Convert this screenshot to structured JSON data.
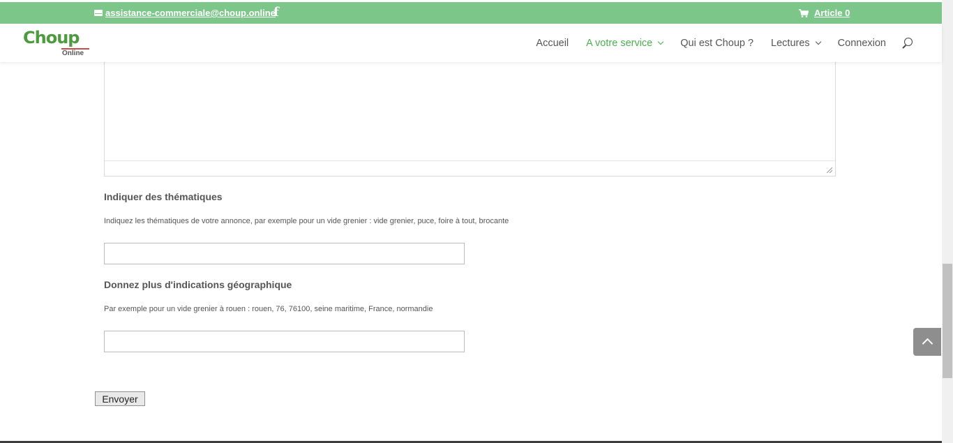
{
  "topbar": {
    "email": "assistance-commerciale@choup.online",
    "facebook_glyph": "f",
    "cart_label": "Article 0",
    "background_color": "#7dc68a"
  },
  "header": {
    "logo": {
      "main": "Choup",
      "sub": "Online"
    },
    "nav": [
      {
        "label": "Accueil",
        "active": false,
        "has_dropdown": false
      },
      {
        "label": "A votre service",
        "active": true,
        "has_dropdown": true
      },
      {
        "label": "Qui est Choup ?",
        "active": false,
        "has_dropdown": false
      },
      {
        "label": "Lectures",
        "active": false,
        "has_dropdown": true
      },
      {
        "label": "Connexion",
        "active": false,
        "has_dropdown": false
      }
    ],
    "accent_color": "#4caf50"
  },
  "form": {
    "thematiques": {
      "label": "Indiquer des thématiques",
      "help": "Indiquez les thématiques de votre annonce, par exemple pour un vide grenier : vide grenier, puce, foire à tout, brocante",
      "value": ""
    },
    "geo": {
      "label": "Donnez plus d'indications géographique",
      "help": "Par exemple pour un vide grenier à rouen : rouen, 76, 76100, seine maritime, France, normandie",
      "value": ""
    },
    "submit_label": "Envoyer"
  },
  "icons": {
    "mail": "mail-icon",
    "facebook": "facebook-icon",
    "cart": "cart-icon",
    "search": "search-icon",
    "to_top": "chevron-up-icon"
  }
}
